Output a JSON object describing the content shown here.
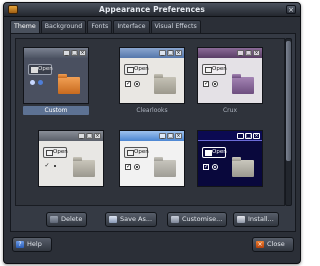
{
  "window": {
    "title": "Appearance Preferences",
    "close_glyph": "×"
  },
  "tabs": [
    {
      "label": "Theme",
      "active": true
    },
    {
      "label": "Background",
      "active": false
    },
    {
      "label": "Fonts",
      "active": false
    },
    {
      "label": "Interface",
      "active": false
    },
    {
      "label": "Visual Effects",
      "active": false
    }
  ],
  "themes": [
    {
      "label": "Custom",
      "selected": true,
      "open_label": "Open",
      "buttons": [
        "_",
        "□",
        "×"
      ]
    },
    {
      "label": "Clearlooks",
      "selected": false,
      "open_label": "Open",
      "buttons": [
        "_",
        "□",
        "×"
      ]
    },
    {
      "label": "Crux",
      "selected": false,
      "open_label": "Open",
      "buttons": [
        "_",
        "□",
        "×"
      ]
    },
    {
      "label": "",
      "selected": false,
      "open_label": "Open",
      "buttons": [
        "_",
        "□",
        "×"
      ]
    },
    {
      "label": "",
      "selected": false,
      "open_label": "Open",
      "buttons": [
        "_",
        "□",
        "×"
      ]
    },
    {
      "label": "",
      "selected": false,
      "open_label": "Open",
      "buttons": [
        "_",
        "□",
        "×"
      ]
    }
  ],
  "checkbox_glyph": "✓",
  "actions": {
    "delete_label": "Delete",
    "save_as_label": "Save As...",
    "customise_label": "Customise...",
    "install_label": "Install..."
  },
  "footer": {
    "help_label": "Help",
    "close_label": "Close",
    "help_glyph": "?",
    "close_glyph": "×"
  }
}
